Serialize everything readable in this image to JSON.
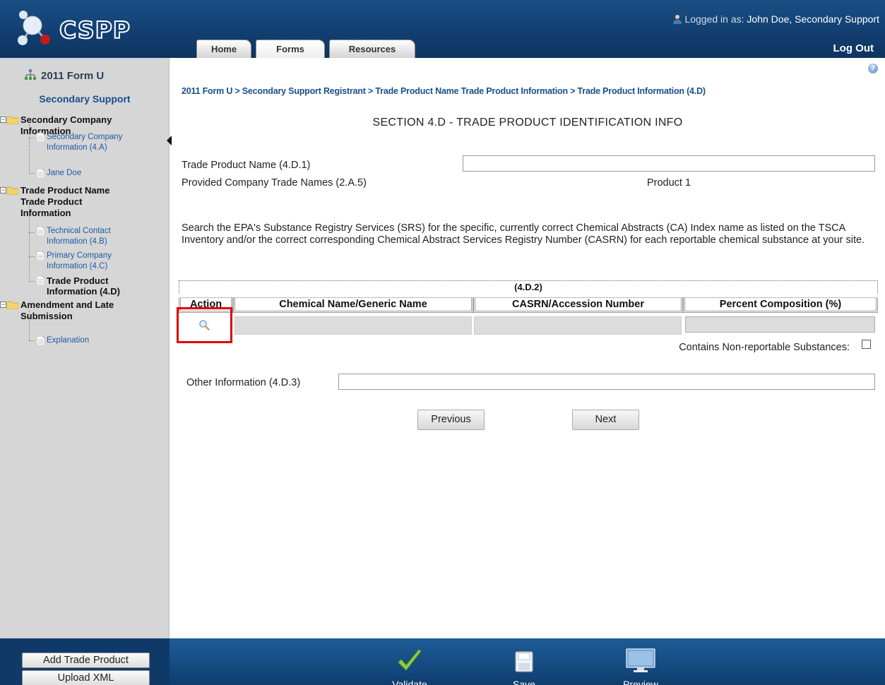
{
  "app": {
    "name": "CSPP"
  },
  "header": {
    "logged_in_prefix": "Logged in as:",
    "user": "John Doe, Secondary Support",
    "logout": "Log Out",
    "tabs": [
      {
        "label": "Home"
      },
      {
        "label": "Forms"
      },
      {
        "label": "Resources"
      }
    ]
  },
  "sidebar": {
    "title": "2011 Form U",
    "subtitle": "Secondary Support",
    "tree": {
      "secondary_company": {
        "label": "Secondary Company Information",
        "children": [
          "Secondary Company Information (4.A)",
          "Jane Doe"
        ]
      },
      "trade_product": {
        "label": "Trade Product Name Trade Product Information",
        "children": [
          "Technical Contact Information (4.B)",
          "Primary Company Information (4.C)",
          "Trade Product Information (4.D)"
        ]
      },
      "amendment": {
        "label": "Amendment and Late Submission",
        "children": [
          "Explanation"
        ]
      }
    }
  },
  "content": {
    "breadcrumb": "2011 Form U > Secondary Support Registrant > Trade Product Name Trade Product Information > Trade Product Information (4.D)",
    "section_title": "SECTION 4.D - TRADE PRODUCT IDENTIFICATION INFO",
    "trade_product_name_label": "Trade Product Name (4.D.1)",
    "trade_product_name_value": "",
    "provided_names_label": "Provided Company Trade Names (2.A.5)",
    "provided_names_value": "Product 1",
    "search_description": "Search the EPA's Substance Registry Services (SRS) for the specific, currently correct Chemical Abstracts (CA) Index name as listed on the TSCA Inventory and/or the correct corresponding Chemical Abstract Services Registry Number (CASRN) for each reportable chemical substance at your site.",
    "table": {
      "caption": "(4.D.2)",
      "headers": [
        "Action",
        "Chemical Name/Generic Name",
        "CASRN/Accession Number",
        "Percent Composition (%)"
      ]
    },
    "non_reportable_label": "Contains Non-reportable Substances:",
    "other_info_label": "Other Information (4.D.3)",
    "other_info_value": "",
    "previous": "Previous",
    "next": "Next"
  },
  "footer": {
    "add_trade_product": "Add Trade Product",
    "upload_xml": "Upload XML",
    "validate": "Validate",
    "save": "Save",
    "preview": "Preview"
  },
  "colors": {
    "header_blue": "#123f70",
    "link_blue": "#1a4f8a",
    "highlight_red": "#e00000",
    "sidebar_gray": "#d6d6d6"
  }
}
